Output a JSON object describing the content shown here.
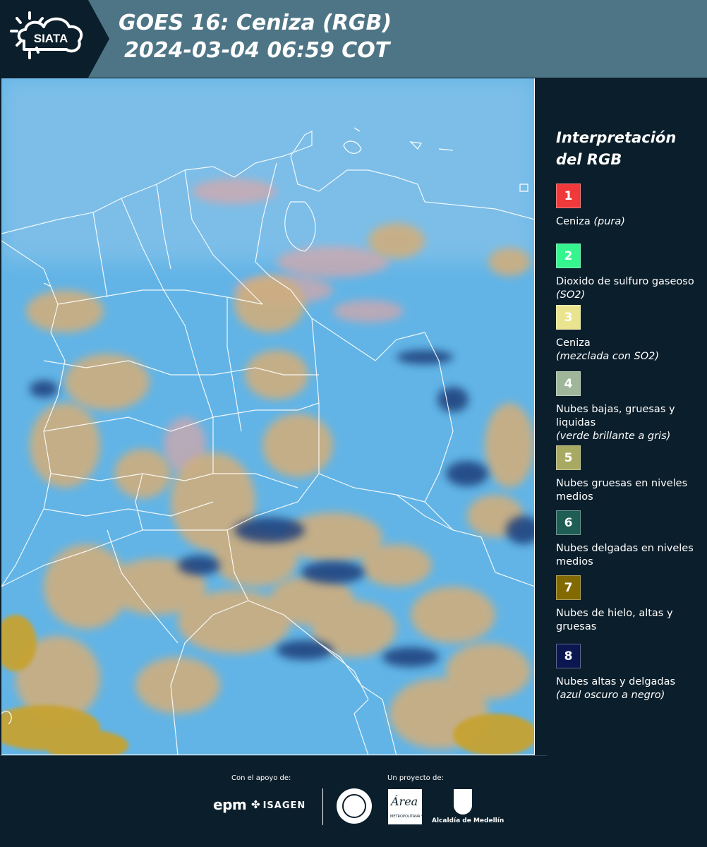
{
  "header": {
    "logo_text": "SIATA",
    "title": "GOES 16: Ceniza (RGB)",
    "subtitle": "2024-03-04 06:59 COT"
  },
  "legend": {
    "title": "Interpretación del RGB",
    "items": [
      {
        "number": "1",
        "color": "#f0393b",
        "label": "Ceniza ",
        "note": "(pura)",
        "note_newline": false
      },
      {
        "number": "2",
        "color": "#35f58f",
        "label": "Dioxido de sulfuro gaseoso ",
        "note": "(SO2)",
        "note_newline": false
      },
      {
        "number": "3",
        "color": "#ebe48e",
        "label": "Ceniza",
        "note": "(mezclada con SO2)",
        "note_newline": true
      },
      {
        "number": "4",
        "color": "#9fb69b",
        "label": "Nubes bajas, gruesas y liquidas",
        "note": "(verde brillante a gris)",
        "note_newline": true
      },
      {
        "number": "5",
        "color": "#a9aa62",
        "label": "Nubes gruesas en niveles medios",
        "note": "",
        "note_newline": false
      },
      {
        "number": "6",
        "color": "#1f5e55",
        "label": "Nubes delgadas en niveles medios",
        "note": "",
        "note_newline": false
      },
      {
        "number": "7",
        "color": "#836a00",
        "label": "Nubes de hielo, altas y gruesas",
        "note": "",
        "note_newline": false
      },
      {
        "number": "8",
        "color": "#0b1751",
        "label": "Nubes altas y delgadas",
        "note": "(azul oscuro a negro)",
        "note_newline": true
      }
    ]
  },
  "footer": {
    "support_label": "Con el apoyo de:",
    "project_label": "Un proyecto de:",
    "sponsor_1": "epm",
    "sponsor_2": "ISAGEN",
    "partner_area": "Área",
    "partner_area_sub": "METROPOLITANA Valle de Aburrá",
    "partner_alcaldia": "Alcaldía de Medellín"
  },
  "map_colors": {
    "background": "#62b4e6",
    "cloud_tan": "#cfae7e",
    "cloud_gold": "#c7a332",
    "cloud_dark": "#1b3d79",
    "cloud_pink": "#dca6a6",
    "boundary": "#ffffff"
  }
}
